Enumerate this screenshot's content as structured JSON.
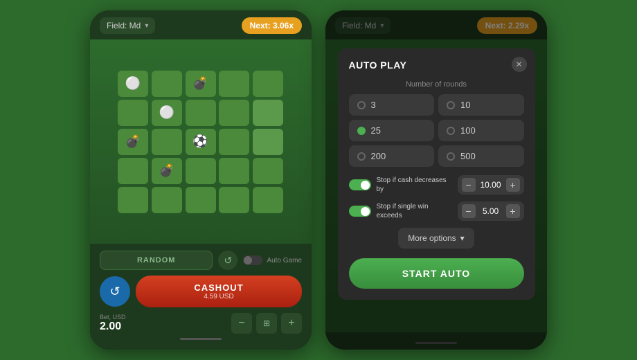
{
  "background": "#2d6b2d",
  "phone_left": {
    "field_label": "Field: Md",
    "next_label": "Next: 3.06x",
    "grid": [
      [
        "white_dot",
        "",
        "bomb",
        "",
        ""
      ],
      [
        "",
        "white_dot",
        "",
        "",
        "light"
      ],
      [
        "bomb",
        "",
        "soccer",
        "",
        "light"
      ],
      [
        "",
        "bomb",
        "",
        "",
        ""
      ],
      [
        "",
        "",
        "",
        "",
        ""
      ]
    ],
    "random_btn": "RANDOM",
    "auto_label": "Auto Game",
    "cashout_label": "CASHOUT",
    "cashout_sub": "4.59 USD",
    "bet_label": "Bet, USD",
    "bet_value": "2.00"
  },
  "phone_right": {
    "field_label": "Field: Md",
    "next_label": "Next: 2.29x",
    "modal": {
      "title": "AUTO PLAY",
      "rounds_label": "Number of rounds",
      "round_options": [
        {
          "value": "3",
          "selected": false
        },
        {
          "value": "10",
          "selected": false
        },
        {
          "value": "25",
          "selected": true
        },
        {
          "value": "100",
          "selected": false
        },
        {
          "value": "200",
          "selected": false
        },
        {
          "value": "500",
          "selected": false
        }
      ],
      "stop_cash_label": "Stop if cash decreases by",
      "stop_cash_value": "10.00",
      "stop_win_label": "Stop if single win exceeds",
      "stop_win_value": "5.00",
      "more_options": "More options",
      "start_auto": "START AUTO"
    }
  }
}
